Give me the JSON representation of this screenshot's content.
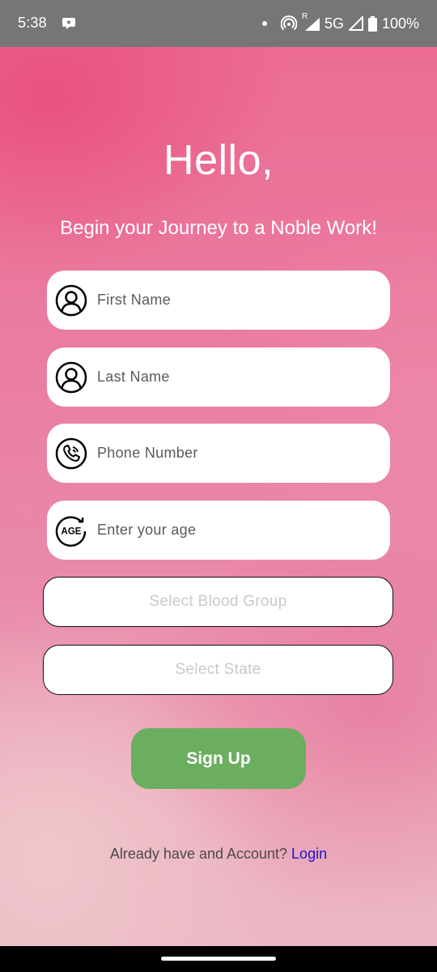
{
  "status_bar": {
    "time": "5:38",
    "network": "5G",
    "roaming": "R",
    "battery": "100%",
    "icons": [
      "chat-bubble-icon",
      "dot-icon",
      "hotspot-icon",
      "signal-icon",
      "battery-icon"
    ]
  },
  "header": {
    "title": "Hello,",
    "subtitle": "Begin your Journey to a Noble Work!"
  },
  "form": {
    "first_name": {
      "placeholder": "First Name",
      "icon": "person-icon"
    },
    "last_name": {
      "placeholder": "Last Name",
      "icon": "person-icon"
    },
    "phone": {
      "placeholder": "Phone Number",
      "icon": "phone-icon"
    },
    "age": {
      "placeholder": "Enter your age",
      "icon": "age-icon",
      "icon_text": "AGE"
    },
    "blood_group": {
      "placeholder": "Select Blood Group"
    },
    "state": {
      "placeholder": "Select State"
    },
    "signup_label": "Sign Up"
  },
  "footer": {
    "prompt": "Already have and Account?",
    "login_label": "Login"
  },
  "colors": {
    "accent_pink": "#ec6c93",
    "button_green": "#6bae60",
    "link_blue": "#1a14d6",
    "status_bar": "#767676"
  }
}
